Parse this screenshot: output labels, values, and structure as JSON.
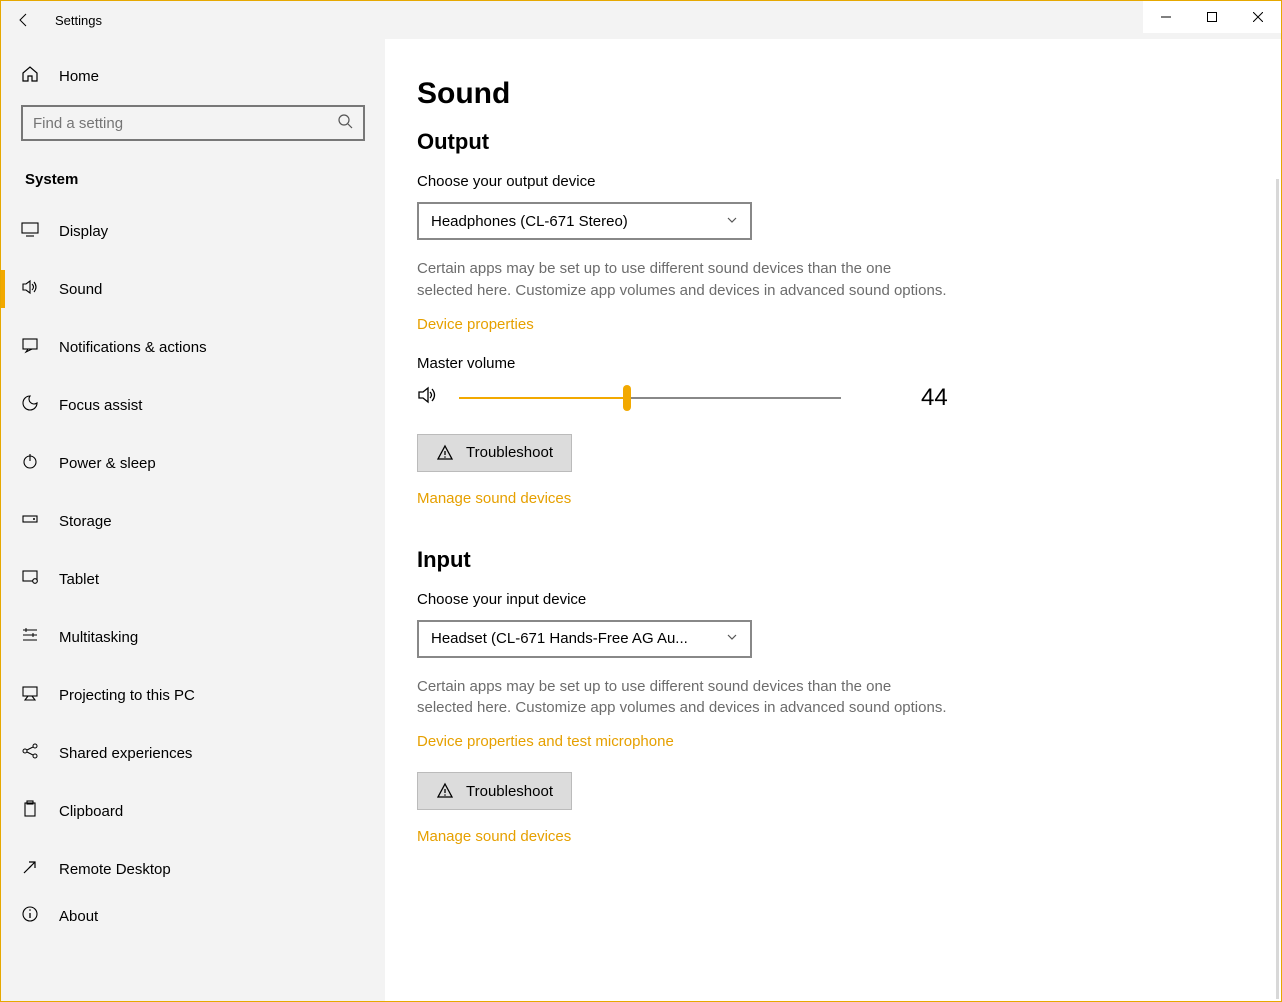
{
  "window": {
    "title": "Settings"
  },
  "sidebar": {
    "home_label": "Home",
    "search_placeholder": "Find a setting",
    "category": "System",
    "items": [
      {
        "label": "Display",
        "icon": "display"
      },
      {
        "label": "Sound",
        "icon": "sound",
        "selected": true
      },
      {
        "label": "Notifications & actions",
        "icon": "notifications"
      },
      {
        "label": "Focus assist",
        "icon": "focus"
      },
      {
        "label": "Power & sleep",
        "icon": "power"
      },
      {
        "label": "Storage",
        "icon": "storage"
      },
      {
        "label": "Tablet",
        "icon": "tablet"
      },
      {
        "label": "Multitasking",
        "icon": "multitask"
      },
      {
        "label": "Projecting to this PC",
        "icon": "projecting"
      },
      {
        "label": "Shared experiences",
        "icon": "shared"
      },
      {
        "label": "Clipboard",
        "icon": "clipboard"
      },
      {
        "label": "Remote Desktop",
        "icon": "remote"
      },
      {
        "label": "About",
        "icon": "about"
      }
    ]
  },
  "content": {
    "page_title": "Sound",
    "output": {
      "heading": "Output",
      "choose_label": "Choose your output device",
      "device": "Headphones (CL-671 Stereo)",
      "description": "Certain apps may be set up to use different sound devices than the one selected here. Customize app volumes and devices in advanced sound options.",
      "device_properties_link": "Device properties",
      "master_volume_label": "Master volume",
      "volume_value": 44,
      "troubleshoot_label": "Troubleshoot",
      "manage_link": "Manage sound devices"
    },
    "input": {
      "heading": "Input",
      "choose_label": "Choose your input device",
      "device": "Headset (CL-671 Hands-Free AG Au...",
      "description": "Certain apps may be set up to use different sound devices than the one selected here. Customize app volumes and devices in advanced sound options.",
      "device_properties_link": "Device properties and test microphone",
      "troubleshoot_label": "Troubleshoot",
      "manage_link": "Manage sound devices"
    }
  },
  "colors": {
    "accent": "#f2a900",
    "link": "#e6a000",
    "sidebar_bg": "#f3f3f3",
    "muted_text": "#6c6c6c"
  }
}
